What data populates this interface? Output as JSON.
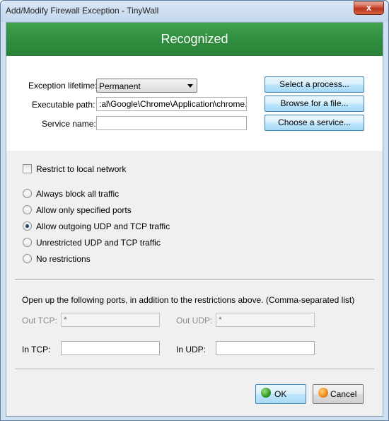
{
  "window": {
    "title": "Add/Modify Firewall Exception - TinyWall",
    "close_glyph": "x"
  },
  "banner": {
    "text": "Recognized",
    "color": "#2f8d3e"
  },
  "form": {
    "lifetime_label": "Exception lifetime:",
    "lifetime_value": "Permanent",
    "path_label": "Executable path:",
    "path_value": ":al\\Google\\Chrome\\Application\\chrome.exe",
    "service_label": "Service name:",
    "service_value": ""
  },
  "buttons": {
    "select_process": "Select a process...",
    "browse_file": "Browse for a file...",
    "choose_service": "Choose a service...",
    "ok": "OK",
    "cancel": "Cancel"
  },
  "restrict_local": {
    "label": "Restrict to local network",
    "checked": false
  },
  "policies": [
    {
      "label": "Always block all traffic",
      "selected": false
    },
    {
      "label": "Allow only specified ports",
      "selected": false
    },
    {
      "label": "Allow outgoing UDP and TCP traffic",
      "selected": true
    },
    {
      "label": "Unrestricted UDP and TCP traffic",
      "selected": false
    },
    {
      "label": "No restrictions",
      "selected": false
    }
  ],
  "ports": {
    "description": "Open up the following ports, in addition to the restrictions above. (Comma-separated list)",
    "out_tcp_label": "Out TCP:",
    "out_tcp_value": "*",
    "out_udp_label": "Out UDP:",
    "out_udp_value": "*",
    "in_tcp_label": "In TCP:",
    "in_tcp_value": "",
    "in_udp_label": "In UDP:",
    "in_udp_value": ""
  },
  "icons": {
    "ok": "green-check-orb-icon",
    "cancel": "orange-cancel-orb-icon"
  }
}
